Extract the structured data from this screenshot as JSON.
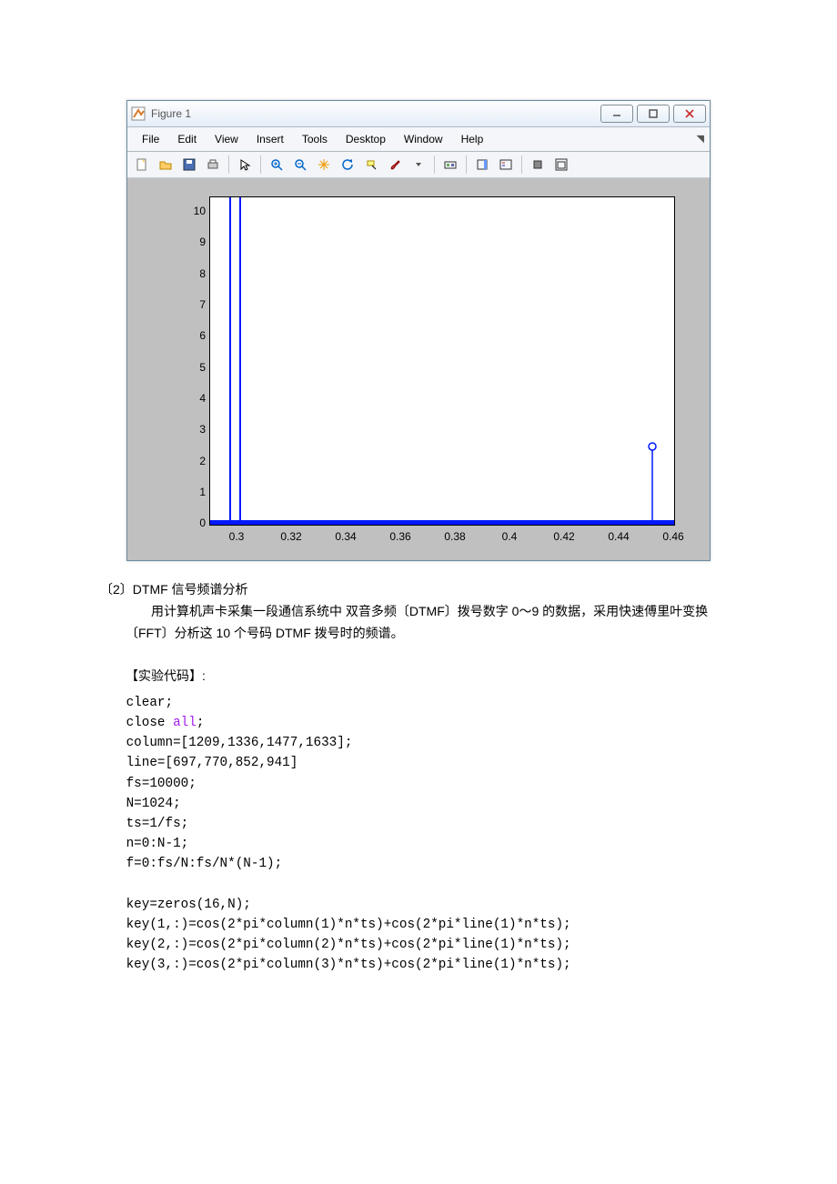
{
  "window": {
    "title": "Figure 1",
    "btn_min_label": "",
    "btn_max_label": "",
    "btn_close_label": ""
  },
  "menu": {
    "items": [
      "File",
      "Edit",
      "View",
      "Insert",
      "Tools",
      "Desktop",
      "Window",
      "Help"
    ]
  },
  "toolbar": {
    "icons": [
      "new-file",
      "open-file",
      "save",
      "print",
      "pointer",
      "zoom-in",
      "zoom-out",
      "pan",
      "rotate",
      "data-cursor",
      "brush",
      "link",
      "colorbar",
      "legend",
      "hide-tools",
      "dock"
    ]
  },
  "chart_data": {
    "type": "line",
    "title": "",
    "xlabel": "",
    "ylabel": "",
    "xlim": [
      0.29,
      0.46
    ],
    "ylim": [
      0,
      10.5
    ],
    "xticks": [
      "0.3",
      "0.32",
      "0.34",
      "0.36",
      "0.38",
      "0.4",
      "0.42",
      "0.44",
      "0.46"
    ],
    "yticks": [
      "0",
      "1",
      "2",
      "3",
      "4",
      "5",
      "6",
      "7",
      "8",
      "9",
      "10"
    ],
    "series": [
      {
        "name": "main",
        "x": [
          0.29,
          0.298,
          0.298,
          0.302,
          0.302,
          0.46
        ],
        "y": [
          0,
          0,
          10.5,
          10.5,
          0,
          0
        ]
      },
      {
        "name": "marker",
        "x": [
          0.452
        ],
        "y": [
          2.5
        ],
        "marker": "o"
      }
    ],
    "extras": {
      "baseline_thick_blue": {
        "x": [
          0.29,
          0.46
        ],
        "y": [
          0,
          0
        ],
        "lw": 4
      },
      "stem_at_0_452": {
        "x": [
          0.452,
          0.452
        ],
        "y": [
          0,
          2.5
        ]
      }
    }
  },
  "text": {
    "heading": "〔2〕DTMF 信号频谱分析",
    "para": "用计算机声卡采集一段通信系统中    双音多频〔DTMF〕拨号数字 0～9 的数据，采用快速傅里叶变换〔FFT〕分析这 10 个号码 DTMF 拨号时的频谱。",
    "codelabel": "【实验代码】:"
  },
  "code": {
    "lines": [
      [
        "clear",
        ";"
      ],
      [
        "close",
        " ",
        "all",
        ";"
      ],
      [
        "plain",
        "column=[1209,1336,1477,1633];"
      ],
      [
        "plain",
        "line=[697,770,852,941]"
      ],
      [
        "plain",
        "fs=10000;"
      ],
      [
        "plain",
        "N=1024;"
      ],
      [
        "plain",
        "ts=1/fs;"
      ],
      [
        "plain",
        "n=0:N-1;"
      ],
      [
        "plain",
        "f=0:fs/N:fs/N*(N-1);"
      ],
      [
        "blank",
        ""
      ],
      [
        "plain",
        "key=zeros(16,N);"
      ],
      [
        "plain",
        "key(1,:)=cos(2*pi*column(1)*n*ts)+cos(2*pi*line(1)*n*ts);"
      ],
      [
        "plain",
        "key(2,:)=cos(2*pi*column(2)*n*ts)+cos(2*pi*line(1)*n*ts);"
      ],
      [
        "plain",
        "key(3,:)=cos(2*pi*column(3)*n*ts)+cos(2*pi*line(1)*n*ts);"
      ]
    ]
  }
}
